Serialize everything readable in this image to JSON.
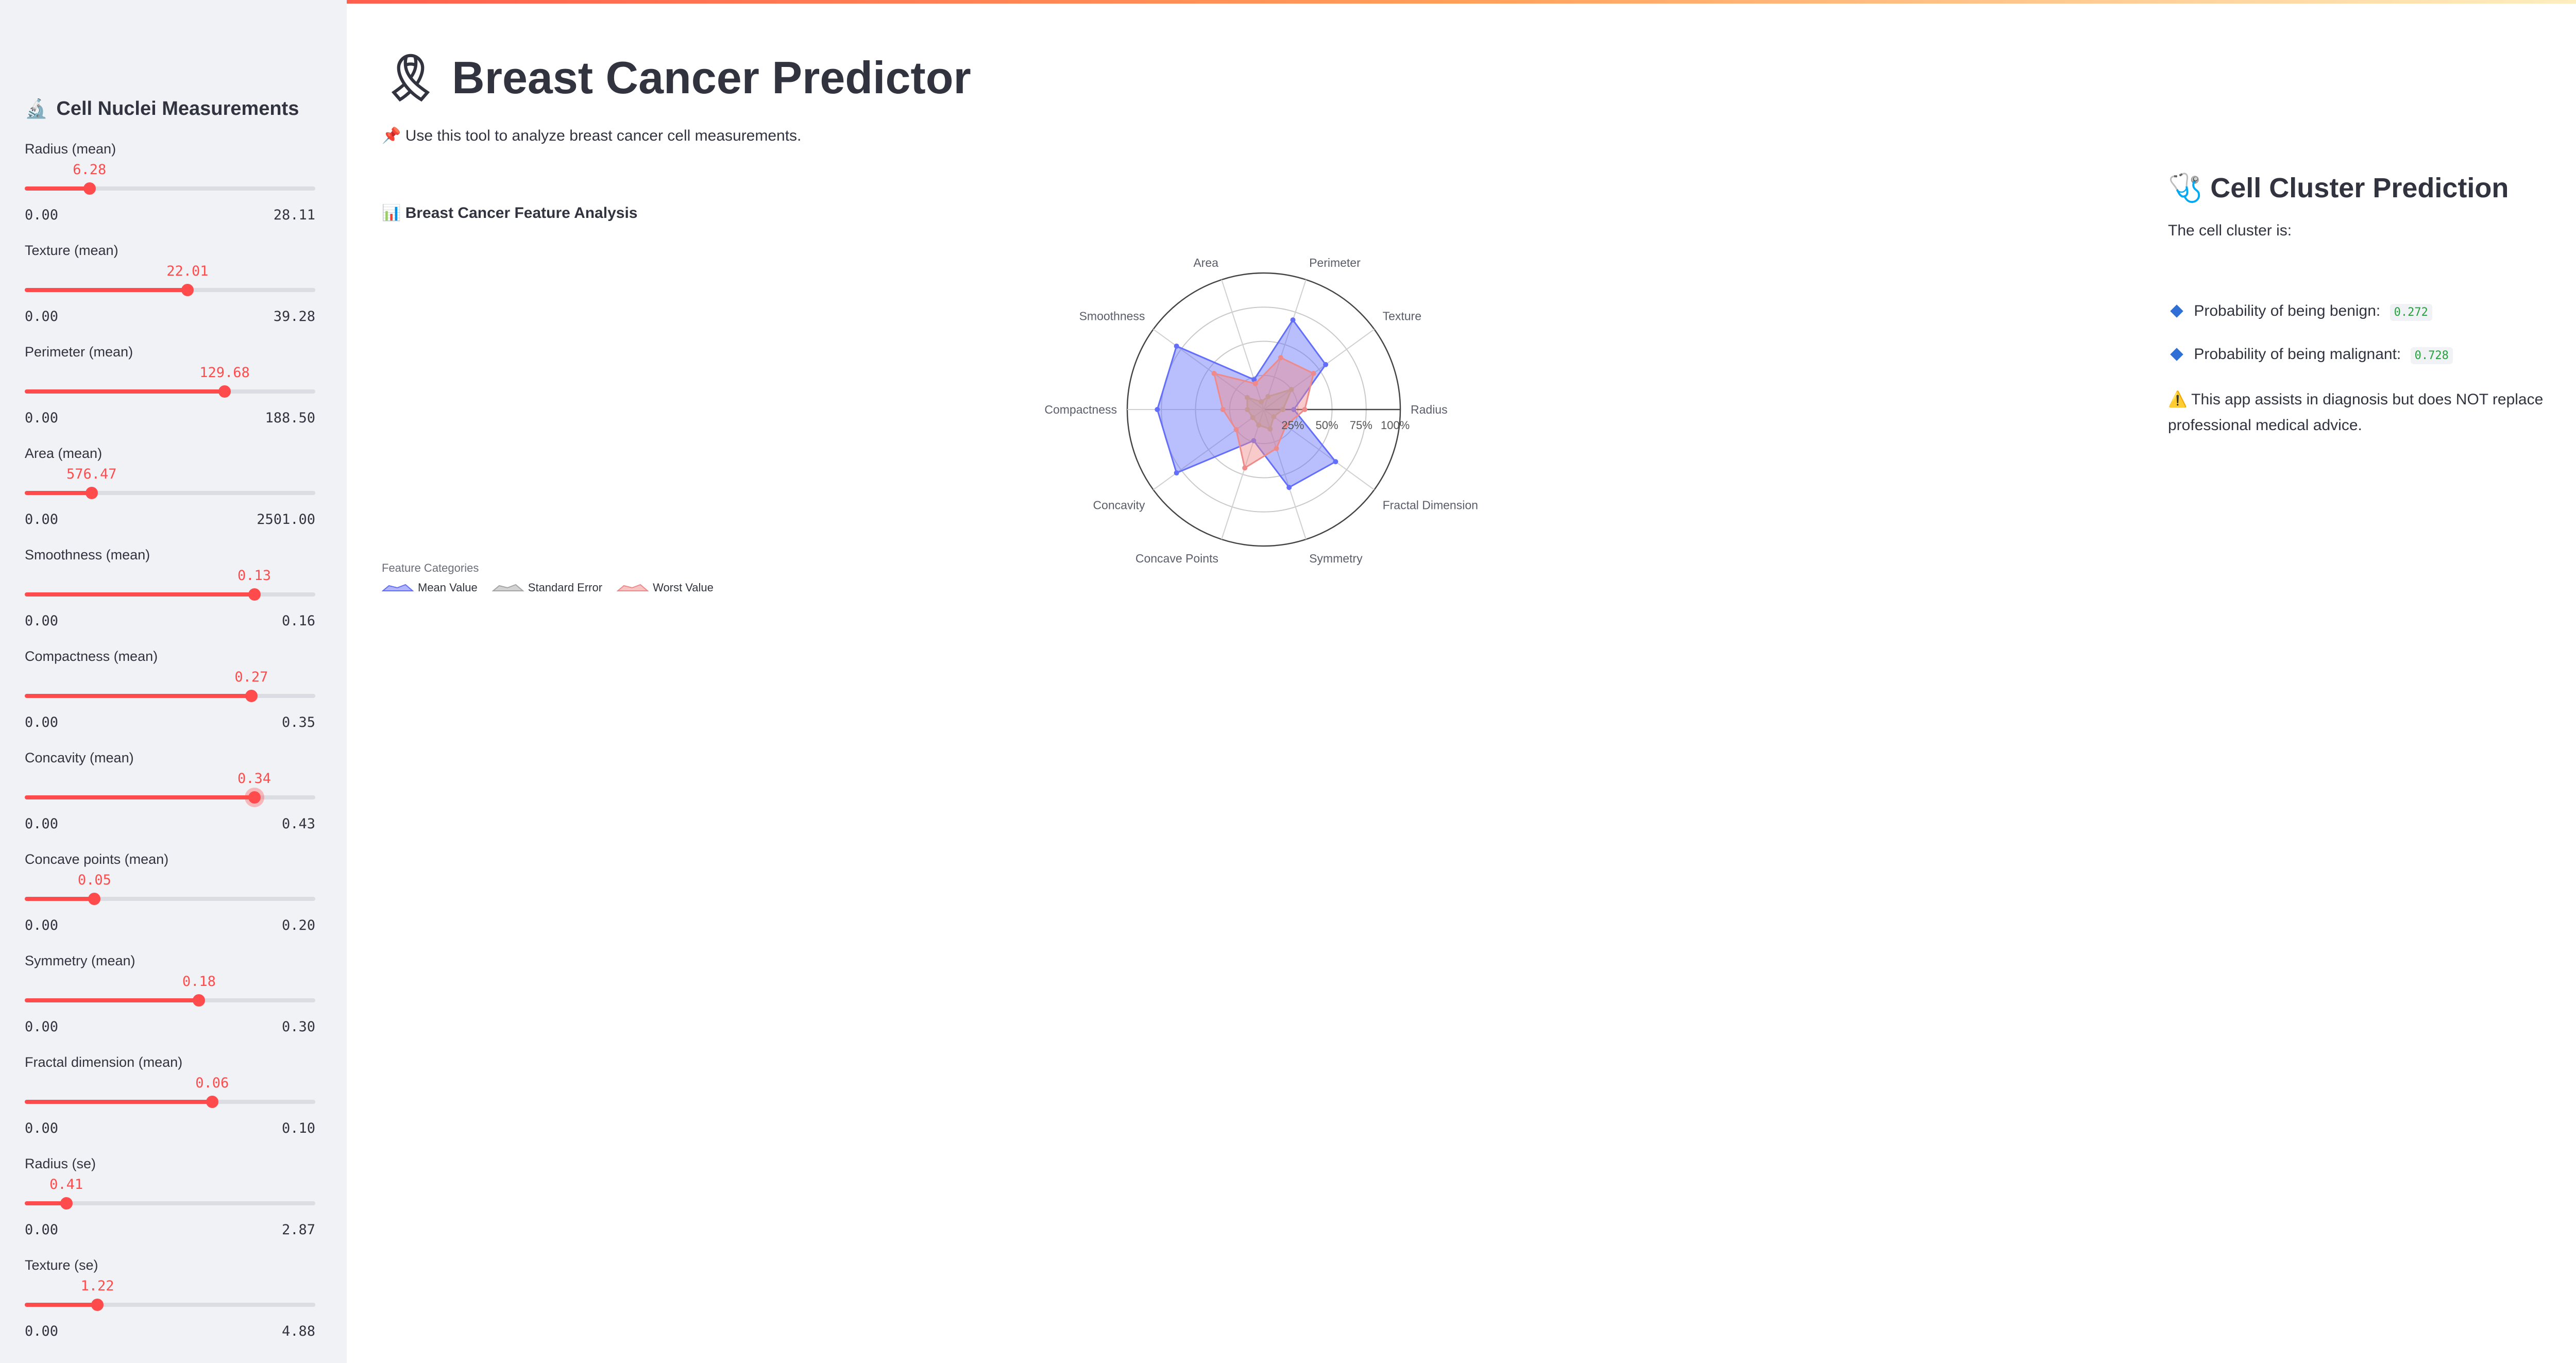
{
  "sidebar": {
    "title_emoji": "🔬",
    "title": "Cell Nuclei Measurements",
    "sliders": [
      {
        "label": "Radius (mean)",
        "value": "6.28",
        "min": "0.00",
        "max": "28.11",
        "fraction": 0.223
      },
      {
        "label": "Texture (mean)",
        "value": "22.01",
        "min": "0.00",
        "max": "39.28",
        "fraction": 0.56
      },
      {
        "label": "Perimeter (mean)",
        "value": "129.68",
        "min": "0.00",
        "max": "188.50",
        "fraction": 0.688
      },
      {
        "label": "Area (mean)",
        "value": "576.47",
        "min": "0.00",
        "max": "2501.00",
        "fraction": 0.23
      },
      {
        "label": "Smoothness (mean)",
        "value": "0.13",
        "min": "0.00",
        "max": "0.16",
        "fraction": 0.79
      },
      {
        "label": "Compactness (mean)",
        "value": "0.27",
        "min": "0.00",
        "max": "0.35",
        "fraction": 0.78
      },
      {
        "label": "Concavity (mean)",
        "value": "0.34",
        "min": "0.00",
        "max": "0.43",
        "fraction": 0.79,
        "active": true
      },
      {
        "label": "Concave points (mean)",
        "value": "0.05",
        "min": "0.00",
        "max": "0.20",
        "fraction": 0.24
      },
      {
        "label": "Symmetry (mean)",
        "value": "0.18",
        "min": "0.00",
        "max": "0.30",
        "fraction": 0.6
      },
      {
        "label": "Fractal dimension (mean)",
        "value": "0.06",
        "min": "0.00",
        "max": "0.10",
        "fraction": 0.645
      },
      {
        "label": "Radius (se)",
        "value": "0.41",
        "min": "0.00",
        "max": "2.87",
        "fraction": 0.143
      },
      {
        "label": "Texture (se)",
        "value": "1.22",
        "min": "0.00",
        "max": "4.88",
        "fraction": 0.25
      }
    ]
  },
  "header": {
    "title_emoji": "🎗",
    "title": "Breast Cancer Predictor",
    "subtitle_emoji": "📌",
    "subtitle": "Use this tool to analyze breast cancer cell measurements."
  },
  "chart_section": {
    "title_emoji": "📊",
    "title": "Breast Cancer Feature Analysis"
  },
  "chart_data": {
    "type": "radar",
    "categories": [
      "Radius",
      "Texture",
      "Perimeter",
      "Area",
      "Smoothness",
      "Compactness",
      "Concavity",
      "Concave Points",
      "Symmetry",
      "Fractal Dimension"
    ],
    "radial_ticks": [
      "25%",
      "50%",
      "75%",
      "100%"
    ],
    "radial_range": [
      0,
      1
    ],
    "legend_title": "Feature Categories",
    "legend_position": "bottom-left",
    "series": [
      {
        "name": "Mean Value",
        "color": "#636efa",
        "values": [
          0.22,
          0.56,
          0.69,
          0.23,
          0.79,
          0.78,
          0.79,
          0.24,
          0.6,
          0.65
        ]
      },
      {
        "name": "Standard Error",
        "color": "#a5a5a5",
        "values": [
          0.14,
          0.25,
          0.1,
          0.06,
          0.15,
          0.12,
          0.1,
          0.12,
          0.15,
          0.09
        ]
      },
      {
        "name": "Worst Value",
        "color": "#ef8a8a",
        "values": [
          0.3,
          0.45,
          0.4,
          0.2,
          0.45,
          0.3,
          0.25,
          0.45,
          0.3,
          0.2
        ]
      }
    ]
  },
  "prediction": {
    "title_emoji": "🩺",
    "title": "Cell Cluster Prediction",
    "intro": "The cell cluster is:",
    "benign_label": "Probability of being benign:",
    "benign_value": "0.272",
    "malignant_label": "Probability of being malignant:",
    "malignant_value": "0.728",
    "disclaimer_emoji": "⚠️",
    "disclaimer": "This app assists in diagnosis but does NOT replace professional medical advice."
  },
  "colors": {
    "accent": "#ff4b4b",
    "sidebar_bg": "#f0f2f6",
    "text": "#31333f",
    "prob_value": "#21a33a"
  }
}
